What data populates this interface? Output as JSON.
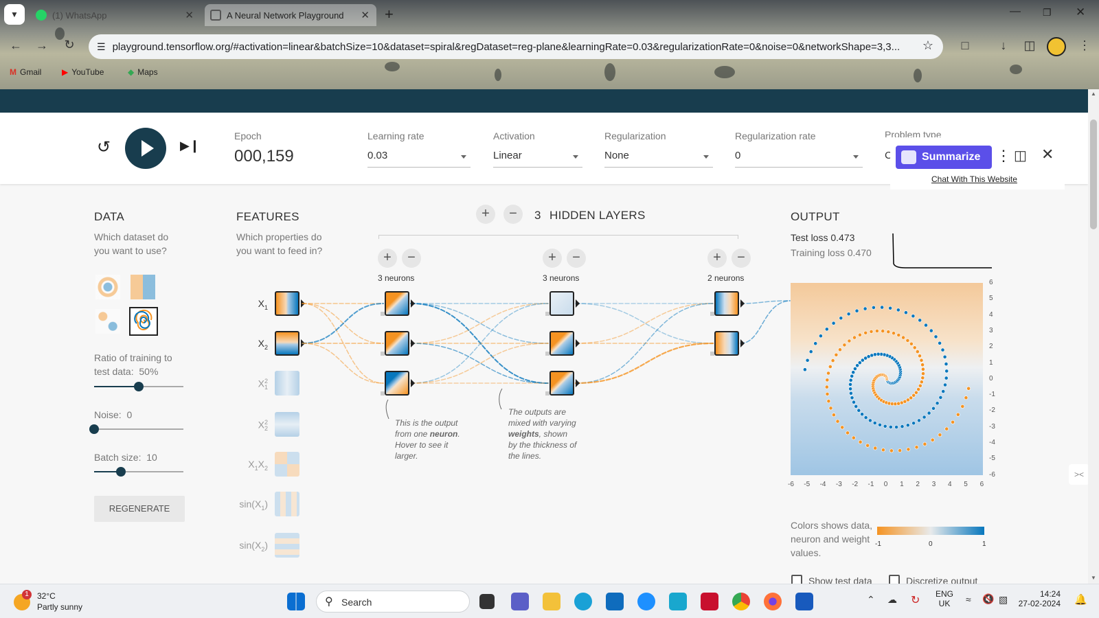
{
  "browser": {
    "tabs": [
      {
        "label": "(1) WhatsApp",
        "active": false
      },
      {
        "label": "A Neural Network Playground",
        "active": true
      }
    ],
    "url": "playground.tensorflow.org/#activation=linear&batchSize=10&dataset=spiral&regDataset=reg-plane&learningRate=0.03&regularizationRate=0&noise=0&networkShape=3,3...",
    "bookmarks": [
      "Gmail",
      "YouTube",
      "Maps"
    ]
  },
  "controls": {
    "epoch_label": "Epoch",
    "epoch_value": "000,159",
    "learning_rate_label": "Learning rate",
    "learning_rate_value": "0.03",
    "activation_label": "Activation",
    "activation_value": "Linear",
    "regularization_label": "Regularization",
    "regularization_value": "None",
    "reg_rate_label": "Regularization rate",
    "reg_rate_value": "0",
    "problem_type_label": "Problem type",
    "problem_type_value": "C"
  },
  "extension": {
    "summarize_label": "Summarize",
    "chat_link": "Chat With This Website"
  },
  "data_panel": {
    "title": "DATA",
    "question": "Which dataset do you want to use?",
    "ratio_label": "Ratio of training to test data:  50%",
    "ratio_value": 0.5,
    "noise_label": "Noise:  0",
    "noise_value": 0,
    "batch_label": "Batch size:  10",
    "batch_value": 0.3,
    "regenerate_label": "REGENERATE",
    "selected_dataset": "spiral"
  },
  "features_panel": {
    "title": "FEATURES",
    "question": "Which properties do you want to feed in?",
    "features": [
      {
        "label": "X",
        "sub": "1",
        "sup": "",
        "active": true
      },
      {
        "label": "X",
        "sub": "2",
        "sup": "",
        "active": true
      },
      {
        "label": "X",
        "sub": "1",
        "sup": "2",
        "active": false
      },
      {
        "label": "X",
        "sub": "2",
        "sup": "2",
        "active": false
      },
      {
        "label": "X",
        "sub": "1",
        "label2": "X",
        "sub2": "2",
        "active": false
      },
      {
        "label": "sin(X",
        "sub": "1",
        "suffix": ")",
        "active": false
      },
      {
        "label": "sin(X",
        "sub": "2",
        "suffix": ")",
        "active": false
      }
    ]
  },
  "network": {
    "layer_count": "3",
    "hidden_layers_label": "HIDDEN LAYERS",
    "layers": [
      {
        "neurons_label": "3 neurons",
        "count": 3
      },
      {
        "neurons_label": "3 neurons",
        "count": 3
      },
      {
        "neurons_label": "2 neurons",
        "count": 2
      }
    ],
    "note1_parts": [
      "This is the output from one ",
      "neuron",
      ". Hover to see it larger."
    ],
    "note2_parts": [
      "The outputs are mixed with varying ",
      "weights",
      ", shown by the thickness of the lines."
    ]
  },
  "output_panel": {
    "title": "OUTPUT",
    "test_loss": "Test loss 0.473",
    "training_loss": "Training loss 0.470",
    "x_ticks": [
      "-6",
      "-5",
      "-4",
      "-3",
      "-2",
      "-1",
      "0",
      "1",
      "2",
      "3",
      "4",
      "5",
      "6"
    ],
    "y_ticks": [
      "6",
      "5",
      "4",
      "3",
      "2",
      "1",
      "0",
      "-1",
      "-2",
      "-3",
      "-4",
      "-5",
      "-6"
    ],
    "legend_text": "Colors shows data, neuron and weight values.",
    "legend_ticks": [
      "-1",
      "0",
      "1"
    ],
    "show_test_label": "Show test data",
    "discretize_label": "Discretize output"
  },
  "colors": {
    "orange": "#f59322",
    "blue": "#0877bd",
    "dark_navy": "#183d4e"
  },
  "taskbar": {
    "weather_temp": "32°C",
    "weather_desc": "Partly sunny",
    "weather_badge": "1",
    "search_label": "Search",
    "lang_top": "ENG",
    "lang_bottom": "UK",
    "time": "14:24",
    "date": "27-02-2024"
  }
}
